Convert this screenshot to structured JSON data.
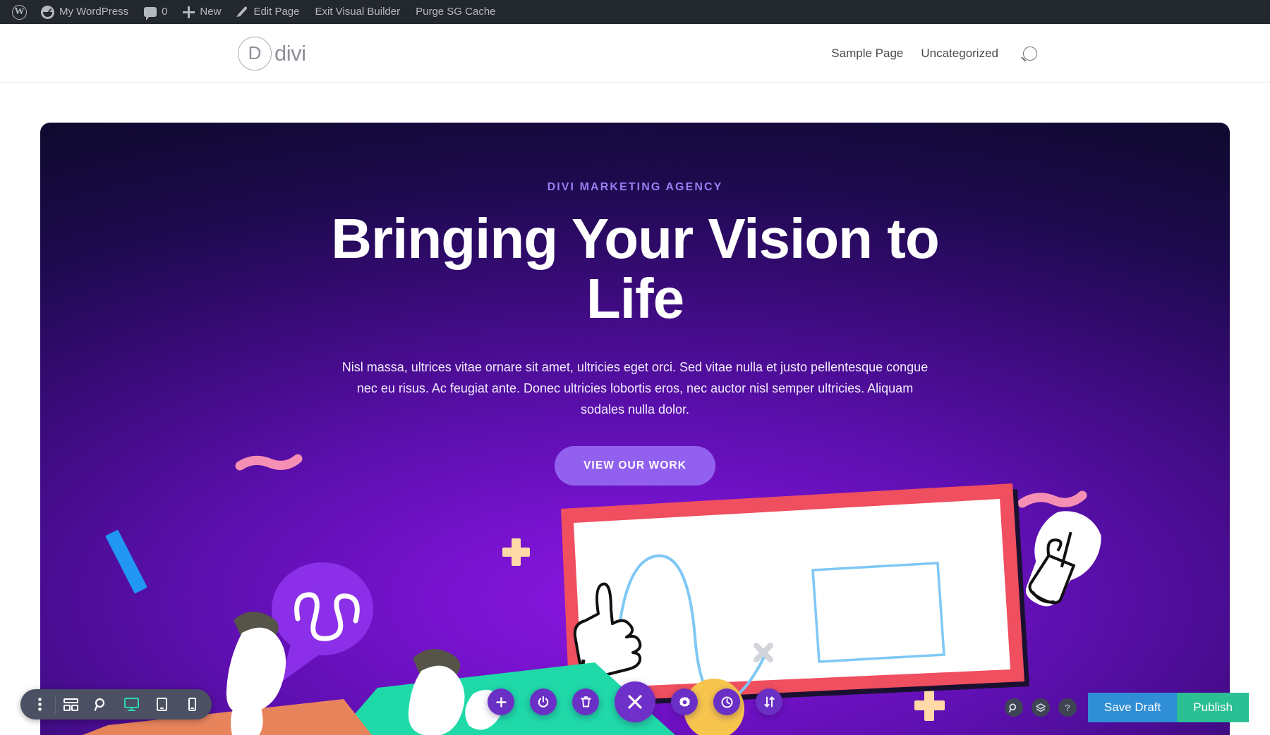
{
  "admin_bar": {
    "items": [
      {
        "id": "wp-logo",
        "icon": "wordpress-logo-icon",
        "label": ""
      },
      {
        "id": "site-name",
        "icon": "dashboard-gauge-icon",
        "label": "My WordPress"
      },
      {
        "id": "comments",
        "icon": "comment-bubble-icon",
        "label": "0"
      },
      {
        "id": "new",
        "icon": "plus-icon",
        "label": "New"
      },
      {
        "id": "edit-page",
        "icon": "pencil-icon",
        "label": "Edit Page"
      },
      {
        "id": "exit-vb",
        "icon": "",
        "label": "Exit Visual Builder"
      },
      {
        "id": "purge-sg",
        "icon": "",
        "label": "Purge SG Cache"
      }
    ]
  },
  "site_header": {
    "brand": {
      "mark": "D",
      "word": "divi",
      "icon": "divi-logo-icon"
    },
    "nav": [
      {
        "label": "Sample Page"
      },
      {
        "label": "Uncategorized"
      }
    ],
    "search_icon": "search-icon"
  },
  "hero": {
    "eyebrow": "DIVI MARKETING AGENCY",
    "title": "Bringing Your Vision to Life",
    "paragraph": "Nisl massa, ultrices vitae ornare sit amet, ultricies eget orci. Sed vitae nulla et justo pellentesque congue nec eu risus. Ac feugiat ante. Donec ultricies lobortis eros, nec auctor nisl semper ultricies. Aliquam sodales nulla dolor.",
    "cta_label": "VIEW OUR WORK",
    "colors": {
      "background_dark": "#0c0828",
      "background_purple": "#8b17e0",
      "eyebrow": "#9b7df2",
      "cta_background": "#9160ef",
      "cta_text": "#ffffff"
    },
    "illustration": {
      "whiteboard_frame": "#ef4f5f",
      "whiteboard_fill": "#ffffff",
      "chart_line": "#7ec8f5",
      "rectangle_outline": "#7ec8f5",
      "speech_bubble": "#8b2fe8",
      "teal_shape": "#1fd9a8",
      "orange_shape": "#e8845c",
      "yellow_circle": "#f7c44e",
      "pink_squiggle": "#f58fb4",
      "blue_bar": "#2196f3",
      "cream_plus": "#ffd9a8",
      "lightbulb": "#ffffff",
      "hair": "#565449"
    }
  },
  "builder_toolbar": {
    "left_buttons": [
      {
        "name": "more-options-icon",
        "label": ""
      },
      {
        "name": "wireframe-icon",
        "label": ""
      },
      {
        "name": "zoom-out-icon",
        "label": ""
      },
      {
        "name": "desktop-icon",
        "label": "",
        "active": true
      },
      {
        "name": "tablet-icon",
        "label": ""
      },
      {
        "name": "phone-icon",
        "label": ""
      }
    ],
    "center_buttons": [
      {
        "name": "add-section-icon",
        "size": "sm"
      },
      {
        "name": "power-toggle-icon",
        "size": "sm"
      },
      {
        "name": "trash-icon",
        "size": "sm"
      },
      {
        "name": "close-menu-icon",
        "size": "lg"
      },
      {
        "name": "settings-gear-icon",
        "size": "sm"
      },
      {
        "name": "history-clock-icon",
        "size": "sm"
      },
      {
        "name": "sort-arrows-icon",
        "size": "sm"
      }
    ],
    "right_icons": [
      {
        "name": "search-icon"
      },
      {
        "name": "layers-icon"
      },
      {
        "name": "help-icon",
        "glyph": "?"
      }
    ],
    "save_draft_label": "Save Draft",
    "publish_label": "Publish",
    "colors": {
      "toolbar_background": "#4b5162",
      "circle_button": "#6a2fc4",
      "active_device": "#2bd9b0",
      "save_draft": "#2f8ed6",
      "publish": "#2bbf94"
    }
  }
}
